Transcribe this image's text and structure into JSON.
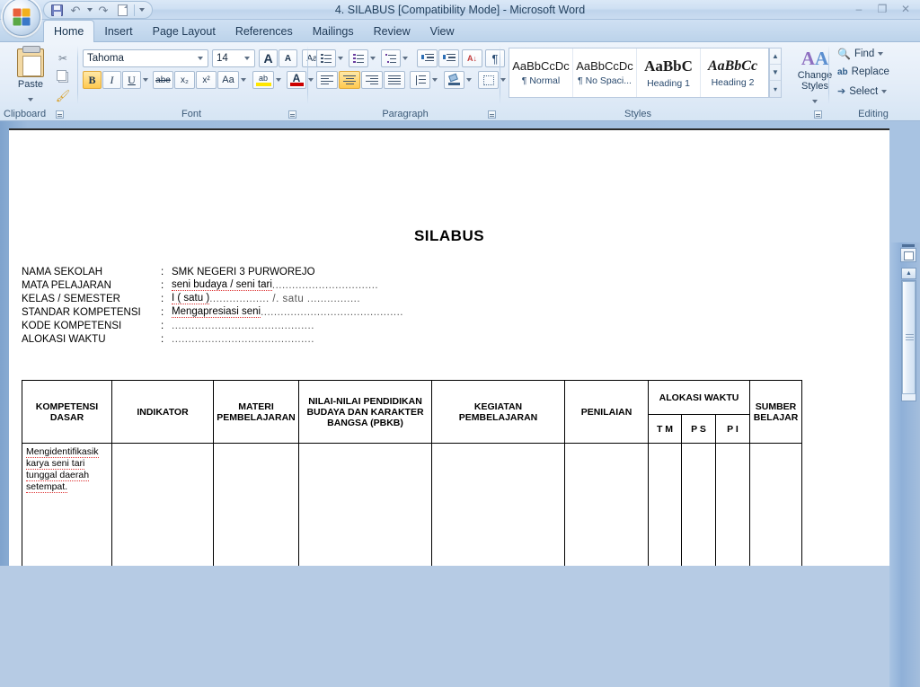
{
  "window": {
    "title": "4. SILABUS [Compatibility Mode] - Microsoft Word",
    "minimize": "–",
    "restore": "❐",
    "close": "✕"
  },
  "quick_access": {
    "save": "save-icon",
    "undo": "undo-icon",
    "undo_dropdown": "chevron-down-icon",
    "redo": "redo-icon",
    "new": "new-document-icon",
    "customize": "chevron-down-icon"
  },
  "tabs": [
    {
      "label": "Home",
      "active": true
    },
    {
      "label": "Insert",
      "active": false
    },
    {
      "label": "Page Layout",
      "active": false
    },
    {
      "label": "References",
      "active": false
    },
    {
      "label": "Mailings",
      "active": false
    },
    {
      "label": "Review",
      "active": false
    },
    {
      "label": "View",
      "active": false
    }
  ],
  "ribbon": {
    "clipboard": {
      "label": "Clipboard",
      "paste": "Paste",
      "cut": "scissors-icon",
      "copy": "copy-icon",
      "format_painter": "paintbrush-icon"
    },
    "font": {
      "label": "Font",
      "font_name": "Tahoma",
      "font_size": "14",
      "grow_font": "A",
      "shrink_font": "A",
      "clear_formatting": "Aa",
      "bold": "B",
      "italic": "I",
      "underline": "U",
      "strikethrough": "abe",
      "subscript": "x₂",
      "superscript": "x²",
      "change_case": "Aa",
      "highlight": "ab",
      "font_color": "A"
    },
    "paragraph": {
      "label": "Paragraph",
      "bullets": "bullet-list-icon",
      "numbering": "numbered-list-icon",
      "multilevel": "multilevel-list-icon",
      "decrease_indent": "decrease-indent-icon",
      "increase_indent": "increase-indent-icon",
      "sort": "sort-icon",
      "show_marks": "¶",
      "align_left": "align-left-icon",
      "align_center": "align-center-icon",
      "align_right": "align-right-icon",
      "justify": "justify-icon",
      "line_spacing": "line-spacing-icon",
      "shading": "shading-icon",
      "borders": "borders-icon"
    },
    "styles": {
      "label": "Styles",
      "items": [
        {
          "preview": "AaBbCcDc",
          "name": "¶ Normal"
        },
        {
          "preview": "AaBbCcDc",
          "name": "¶ No Spaci..."
        },
        {
          "preview": "AaBbC",
          "name": "Heading 1"
        },
        {
          "preview": "AaBbCc",
          "name": "Heading 2"
        }
      ],
      "change_styles": "Change Styles"
    },
    "editing": {
      "label": "Editing",
      "find": "Find",
      "replace": "Replace",
      "select": "Select"
    }
  },
  "document": {
    "title": "SILABUS",
    "meta": [
      {
        "label": "NAMA SEKOLAH",
        "colon": ":",
        "value": "SMK NEGERI 3 PURWOREJO",
        "misspelled": false,
        "dots": ""
      },
      {
        "label": "MATA PELAJARAN",
        "colon": ":",
        "value": "seni budaya / seni tari",
        "misspelled": true,
        "dots": "................................"
      },
      {
        "label": "KELAS / SEMESTER",
        "colon": ":",
        "value": "I  ( satu )",
        "misspelled": true,
        "dots": ".................. /.  satu ................"
      },
      {
        "label": "STANDAR KOMPETENSI",
        "colon": ":",
        "value": "Mengapresiasi seni",
        "misspelled": true,
        "dots": "..........................................."
      },
      {
        "label": "KODE KOMPETENSI",
        "colon": ":",
        "value": "",
        "misspelled": false,
        "dots": "..........................................."
      },
      {
        "label": "ALOKASI WAKTU",
        "colon": ":",
        "value": "",
        "misspelled": false,
        "dots": "..........................................."
      }
    ],
    "table": {
      "headers_main": [
        "KOMPETENSI DASAR",
        "INDIKATOR",
        "MATERI PEMBELAJARAN",
        "NILAI-NILAI PENDIDIKAN BUDAYA DAN KARAKTER BANGSA (PBKB)",
        "KEGIATAN PEMBELAJARAN",
        "PENILAIAN",
        "ALOKASI WAKTU",
        "SUMBER BELAJAR"
      ],
      "alokasi_sub": [
        "T M",
        "P S",
        "P I"
      ],
      "rows": [
        {
          "kompetensi_dasar": "Mengidentifikasik karya seni tari tunggal daerah setempat.",
          "indikator": "",
          "materi": "",
          "pbkb": "",
          "kegiatan": "",
          "penilaian": "",
          "tm": "",
          "ps": "",
          "pi": "",
          "sumber": ""
        }
      ]
    }
  },
  "scrollbar": {
    "up_arrow": "▲",
    "select_browse_object": "browse-object-icon"
  },
  "colors": {
    "accent": "#ffc94f",
    "chrome": "#bcd3ea",
    "spell_error": "#dd3333",
    "text": "#1f3a57"
  }
}
